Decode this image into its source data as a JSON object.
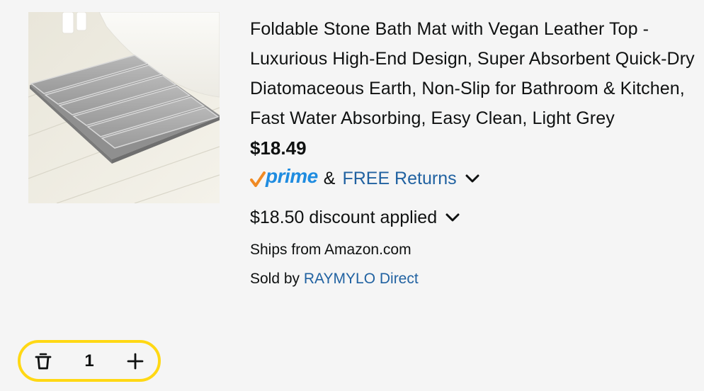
{
  "product": {
    "title": "Foldable Stone Bath Mat with Vegan Leather Top - Luxurious High-End Design, Super Absorbent Quick-Dry Diatomaceous Earth, Non-Slip for Bathroom & Kitchen, Fast Water Absorbing, Easy Clean, Light Grey",
    "price": "$18.49",
    "prime_label": "prime",
    "ampersand": "&",
    "free_returns": "FREE Returns",
    "discount": "$18.50 discount applied",
    "ships_from": "Ships from Amazon.com",
    "sold_by_prefix": "Sold by",
    "seller": "RAYMYLO Direct"
  },
  "quantity": {
    "value": "1",
    "delete_icon": "trash-icon",
    "plus_icon": "plus-icon"
  },
  "colors": {
    "prime_blue": "#1f8ce0",
    "prime_check": "#f08a24",
    "link": "#2162a1",
    "stepper_border": "#ffd814"
  }
}
